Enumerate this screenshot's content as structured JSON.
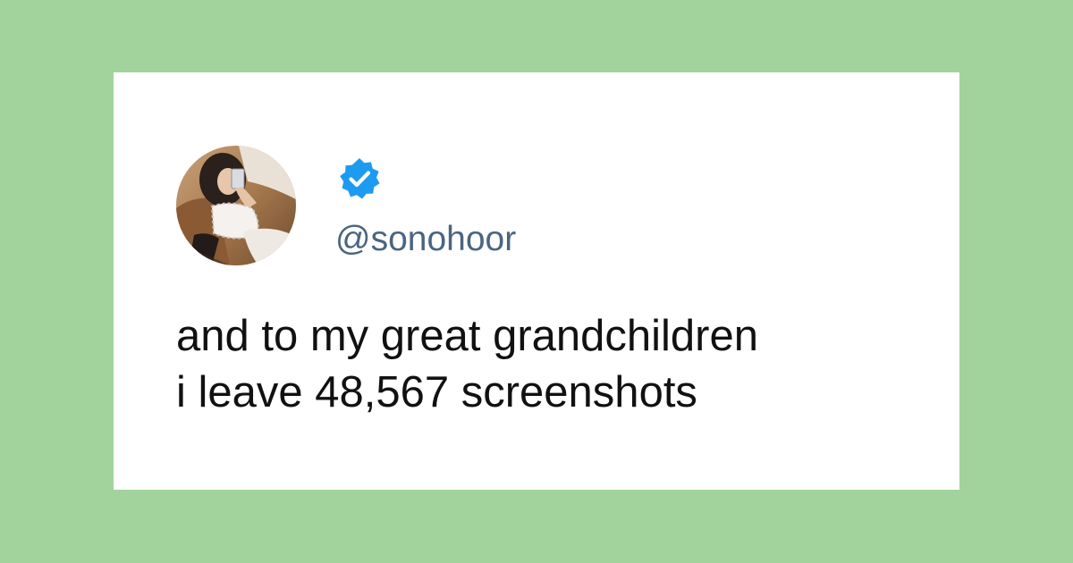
{
  "page": {
    "background_color": "#a3d39d",
    "card_color": "#ffffff"
  },
  "tweet": {
    "avatar": {
      "icon": "profile-photo"
    },
    "verified_badge": {
      "icon": "verified-check-icon",
      "color": "#1d9bf0"
    },
    "handle": "@sonohoor",
    "text_lines": [
      "and to my great grandchildren",
      "i leave 48,567 screenshots"
    ]
  }
}
